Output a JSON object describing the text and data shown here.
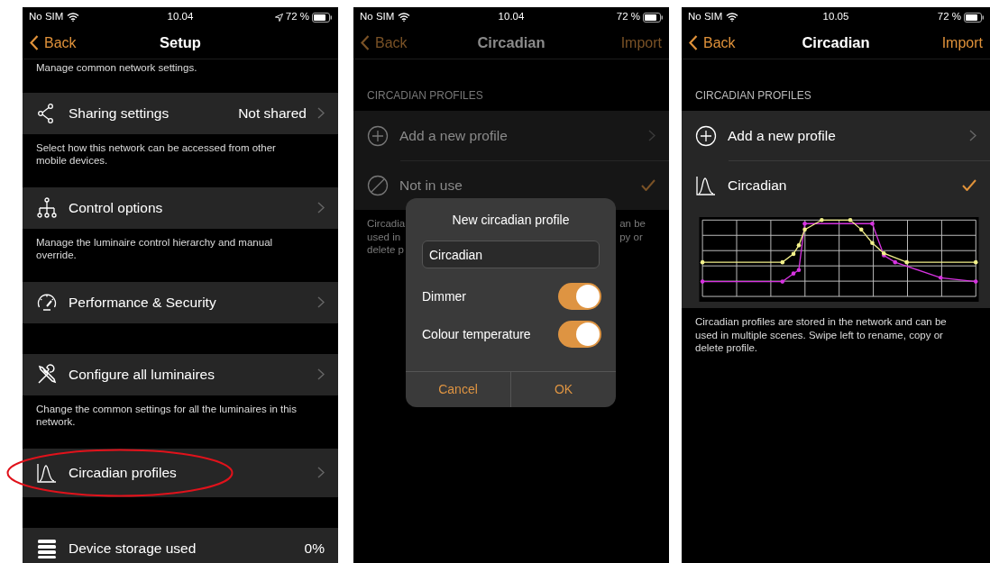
{
  "screens": [
    {
      "status_bar": {
        "carrier": "No SIM",
        "time": "10.04",
        "location": true,
        "battery": "72 %"
      },
      "nav": {
        "back": "Back",
        "title": "Setup"
      },
      "dimmed": false,
      "rows": [
        {
          "kind": "note",
          "text": "Manage common network settings."
        },
        {
          "kind": "cell",
          "label": "Sharing settings",
          "value": "Not shared",
          "chevron": true
        },
        {
          "kind": "note",
          "text": "Select how this network can be accessed from other mobile devices."
        },
        {
          "kind": "cell",
          "label": "Control options",
          "chevron": true
        },
        {
          "kind": "note",
          "text": "Manage the luminaire control hierarchy and manual override."
        },
        {
          "kind": "cell",
          "label": "Performance & Security",
          "chevron": true
        },
        {
          "kind": "gap"
        },
        {
          "kind": "cell",
          "label": "Configure all luminaires",
          "chevron": true
        },
        {
          "kind": "note",
          "text": "Change the common settings for all the luminaires in this network."
        },
        {
          "kind": "cell",
          "label": "Circadian profiles",
          "chevron": true,
          "highlighted": true
        },
        {
          "kind": "gap"
        },
        {
          "kind": "cell",
          "label": "Device storage used",
          "value": "0%",
          "chevron": false
        }
      ]
    },
    {
      "status_bar": {
        "carrier": "No SIM",
        "time": "10.04",
        "location": false,
        "battery": "72 %"
      },
      "nav": {
        "back": "Back",
        "title": "Circadian",
        "action": "Import"
      },
      "dimmed": true,
      "rows": [
        {
          "kind": "header",
          "text": "CIRCADIAN PROFILES"
        },
        {
          "kind": "cell",
          "label": "Add a new profile",
          "chevron": true,
          "selected": false
        },
        {
          "kind": "cell",
          "label": "Not in use",
          "chevron": false,
          "selected": true
        },
        {
          "kind": "split_note",
          "left_lines": [
            "Circadia",
            "used in",
            "delete p"
          ],
          "right_lines": [
            "an be",
            "py or"
          ]
        }
      ],
      "dialog": {
        "title": "New circadian profile",
        "field_value": "Circadian",
        "toggles": [
          {
            "label": "Dimmer",
            "on": true
          },
          {
            "label": "Colour temperature",
            "on": true
          }
        ],
        "buttons": [
          "Cancel",
          "OK"
        ]
      }
    },
    {
      "status_bar": {
        "carrier": "No SIM",
        "time": "10.05",
        "location": false,
        "battery": "72 %"
      },
      "nav": {
        "back": "Back",
        "title": "Circadian",
        "action": "Import"
      },
      "dimmed": false,
      "rows": [
        {
          "kind": "header",
          "text": "CIRCADIAN PROFILES"
        },
        {
          "kind": "cell",
          "label": "Add a new profile",
          "chevron": true,
          "selected": false
        },
        {
          "kind": "cell",
          "label": "Circadian",
          "chevron": false,
          "selected": true
        },
        {
          "kind": "chart"
        },
        {
          "kind": "note",
          "text": "Circadian profiles are stored in the network and can be used in multiple scenes. Swipe left to rename, copy or delete profile."
        }
      ]
    }
  ]
}
